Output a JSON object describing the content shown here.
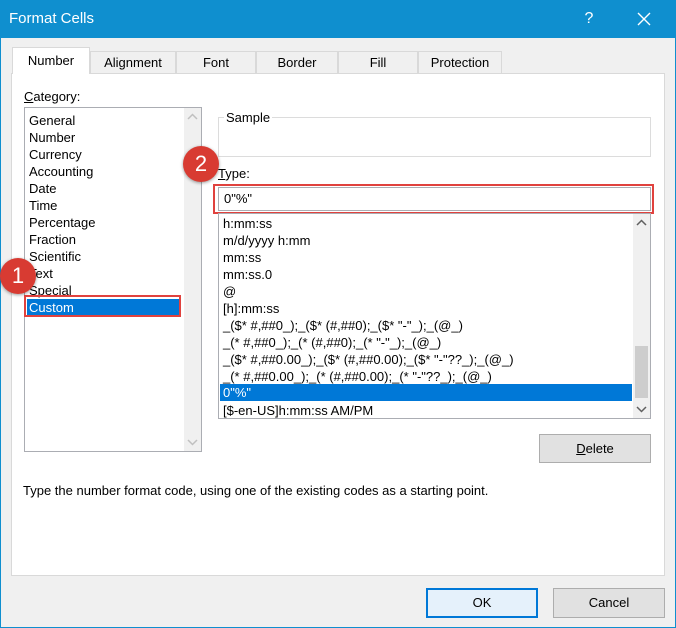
{
  "window": {
    "title": "Format Cells",
    "help_label": "?"
  },
  "tabs": [
    {
      "label": "Number",
      "active": true
    },
    {
      "label": "Alignment",
      "active": false
    },
    {
      "label": "Font",
      "active": false
    },
    {
      "label": "Border",
      "active": false
    },
    {
      "label": "Fill",
      "active": false
    },
    {
      "label": "Protection",
      "active": false
    }
  ],
  "category": {
    "label_prefix": "C",
    "label_rest": "ategory:",
    "items": [
      "General",
      "Number",
      "Currency",
      "Accounting",
      "Date",
      "Time",
      "Percentage",
      "Fraction",
      "Scientific",
      "Text",
      "Special",
      "Custom"
    ],
    "selected": "Custom"
  },
  "sample": {
    "label": "Sample",
    "value": ""
  },
  "type": {
    "label_prefix": "T",
    "label_rest": "ype:",
    "value": "0\"%\"",
    "formats": [
      "h:mm:ss",
      "m/d/yyyy h:mm",
      "mm:ss",
      "mm:ss.0",
      "@",
      "[h]:mm:ss",
      "_($* #,##0_);_($* (#,##0);_($* \"-\"_);_(@_)",
      "_(* #,##0_);_(* (#,##0);_(* \"-\"_);_(@_)",
      "_($* #,##0.00_);_($* (#,##0.00);_($* \"-\"??_);_(@_)",
      "_(* #,##0.00_);_(* (#,##0.00);_(* \"-\"??_);_(@_)",
      "0\"%\"",
      "[$-en-US]h:mm:ss AM/PM"
    ],
    "selected": "0\"%\""
  },
  "buttons": {
    "delete_prefix": "D",
    "delete_rest": "elete",
    "ok": "OK",
    "cancel": "Cancel"
  },
  "description": "Type the number format code, using one of the existing codes as a starting point.",
  "callouts": {
    "one": "1",
    "two": "2"
  },
  "colors": {
    "titlebar": "#0f8fcf",
    "selection": "#0078d7",
    "callout": "#d83b32",
    "highlight_border": "#e0423e"
  }
}
